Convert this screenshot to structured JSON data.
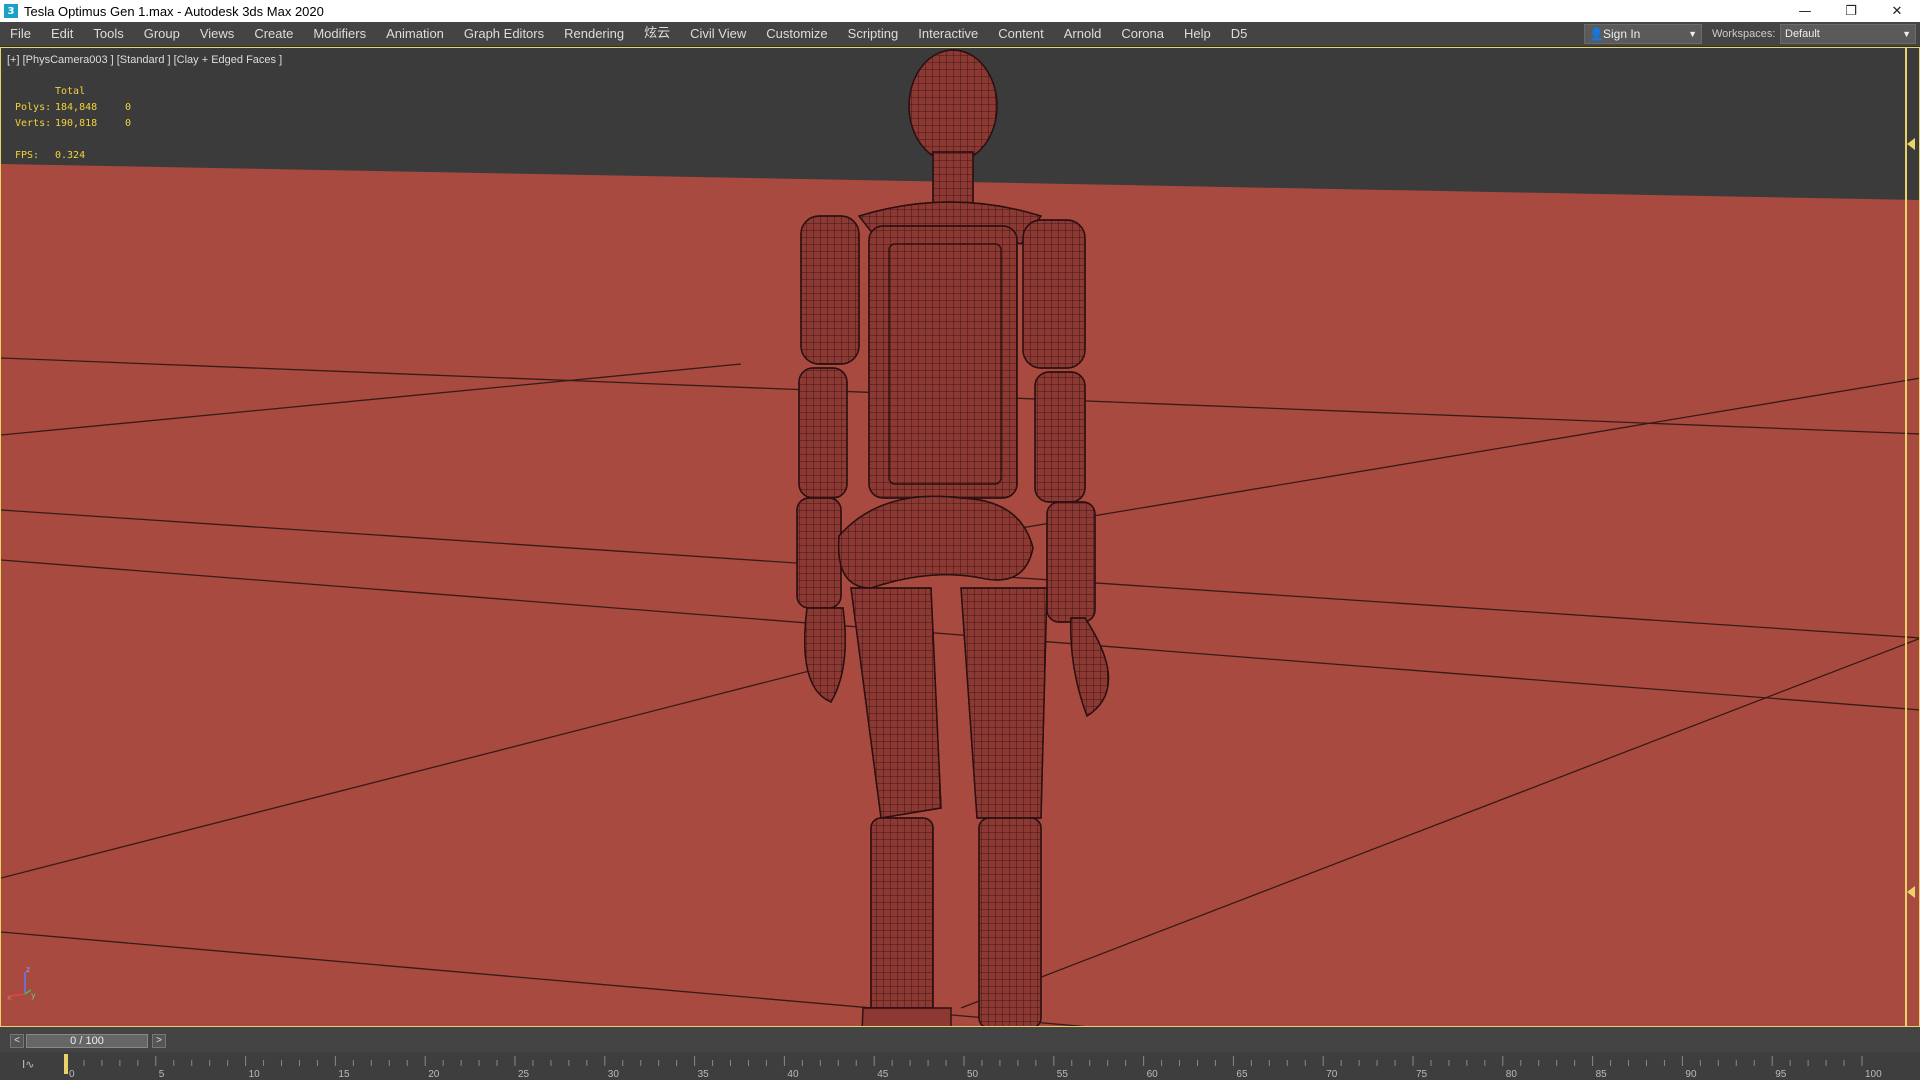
{
  "window": {
    "title": "Tesla Optimus Gen 1.max - Autodesk 3ds Max 2020",
    "app_icon": "3ds-max-icon",
    "controls": [
      "minimize",
      "restore",
      "close"
    ]
  },
  "menu": {
    "items": [
      "File",
      "Edit",
      "Tools",
      "Group",
      "Views",
      "Create",
      "Modifiers",
      "Animation",
      "Graph Editors",
      "Rendering",
      "炫云",
      "Civil View",
      "Customize",
      "Scripting",
      "Interactive",
      "Content",
      "Arnold",
      "Corona",
      "Help",
      "D5"
    ],
    "sign_in": "Sign In",
    "workspaces_label": "Workspaces:",
    "workspace_value": "Default"
  },
  "viewport": {
    "label": "[+] [PhysCamera003 ] [Standard ] [Clay + Edged Faces ]",
    "stats": {
      "header": "Total",
      "polys_label": "Polys:",
      "polys_value": "184,848",
      "polys_sel": "0",
      "verts_label": "Verts:",
      "verts_value": "190,818",
      "verts_sel": "0",
      "fps_label": "FPS:",
      "fps_value": "0.324"
    },
    "axis_labels": {
      "z": "z",
      "x": "x",
      "y": "y"
    },
    "ground_color": "#a84a3f",
    "model_color": "#8c3833",
    "wire_color": "#2b1010"
  },
  "timeline": {
    "frame_display": "0 / 100",
    "prev": "<",
    "next": ">",
    "ticks": [
      "0",
      "5",
      "10",
      "15",
      "20",
      "25",
      "30",
      "35",
      "40",
      "45",
      "50",
      "55",
      "60",
      "65",
      "70",
      "75",
      "80",
      "85",
      "90",
      "95",
      "100"
    ]
  }
}
